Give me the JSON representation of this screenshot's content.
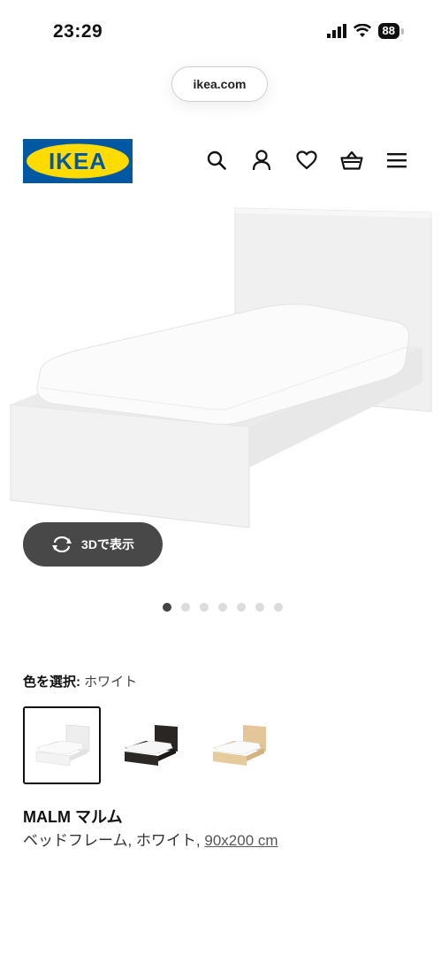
{
  "status_bar": {
    "time": "23:29",
    "battery": "88"
  },
  "browser": {
    "url": "ikea.com"
  },
  "header": {
    "logo_text": "IKEA"
  },
  "gallery": {
    "view_3d_label": "3Dで表示",
    "dot_count": 7,
    "active_dot": 1
  },
  "color_select": {
    "label": "色を選択:",
    "selected_value": "ホワイト",
    "options": [
      {
        "name": "white-bed-swatch",
        "color": "#f4f4f4",
        "selected": true
      },
      {
        "name": "black-brown-bed-swatch",
        "color": "#2a2623",
        "selected": false
      },
      {
        "name": "oak-veneer-bed-swatch",
        "color": "#e3c79a",
        "selected": false
      }
    ]
  },
  "product": {
    "name": "MALM マルム",
    "description": "ベッドフレーム, ホワイト, ",
    "size": "90x200 cm"
  },
  "colors": {
    "ikea_blue": "#0058a3",
    "ikea_yellow": "#ffdb00",
    "button_dark": "#484848"
  }
}
